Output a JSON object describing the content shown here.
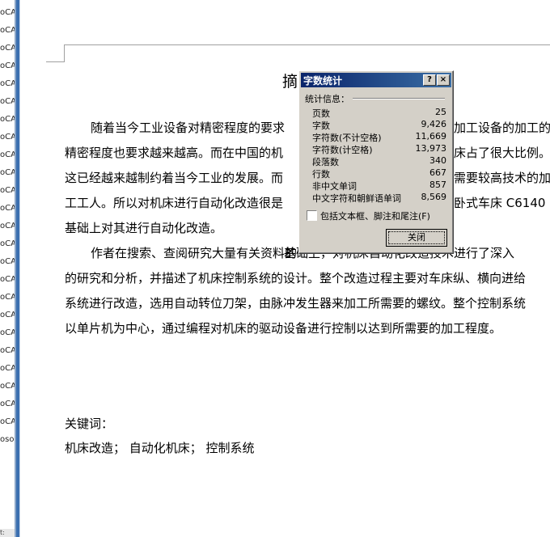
{
  "left_panel": {
    "rows": [
      "oCA",
      "oCA",
      "oCA",
      "oCA",
      "oCA",
      "oCA",
      "oCA",
      "oCA",
      "oCA",
      "oCA",
      "oCA",
      "oCA",
      "oCA",
      "oCA",
      "oCA",
      "oCA",
      "oCA",
      "oCA",
      "oCA",
      "oCA",
      "oCA",
      "oCA",
      "oCA",
      "oCA",
      "oso"
    ],
    "bottom_label": "t:"
  },
  "document": {
    "title": "摘",
    "paragraphs": [
      "随着当今工业设备对精密程度的要求",
      "精密程度也要求越来越高。而在中国的机",
      "这已经越来越制约着当今工业的发展。而",
      "工工人。所以对机床进行自动化改造很是",
      "基础上对其进行自动化改造。",
      "作者在搜索、查阅研究大量有关资料的",
      "的研究和分析，并描述了机床控制系统的设计。整个改造过程主要对车床纵、横向进给",
      "系统进行改造，选用自动转位刀架，由脉冲发生器来加工所需要的螺纹。整个控制系统",
      "以单片机为中心，通过编程对机床的驱动设备进行控制以达到所需要的加工程度。"
    ],
    "right_fragments": [
      "加工设备的加工的",
      "床占了很大比例。",
      "需要较高技术的加",
      "卧式车床 C6140 的"
    ],
    "overlay_fragment": "基础上，对机床自动化改造技术进行了深入",
    "keywords_label": "关键词：",
    "keywords": "机床改造；  自动化机床；  控制系统"
  },
  "dialog": {
    "title": "字数统计",
    "help_label": "?",
    "close_x_label": "×",
    "section_label": "统计信息：",
    "stats": [
      {
        "label": "页数",
        "value": "25"
      },
      {
        "label": "字数",
        "value": "9,426"
      },
      {
        "label": "字符数(不计空格)",
        "value": "11,669"
      },
      {
        "label": "字符数(计空格)",
        "value": "13,973"
      },
      {
        "label": "段落数",
        "value": "340"
      },
      {
        "label": "行数",
        "value": "667"
      },
      {
        "label": "非中文单词",
        "value": "857"
      },
      {
        "label": "中文字符和朝鲜语单词",
        "value": "8,569"
      }
    ],
    "checkbox_label": "包括文本框、脚注和尾注(F)",
    "checkbox_checked": false,
    "close_button_label": "关闭"
  }
}
